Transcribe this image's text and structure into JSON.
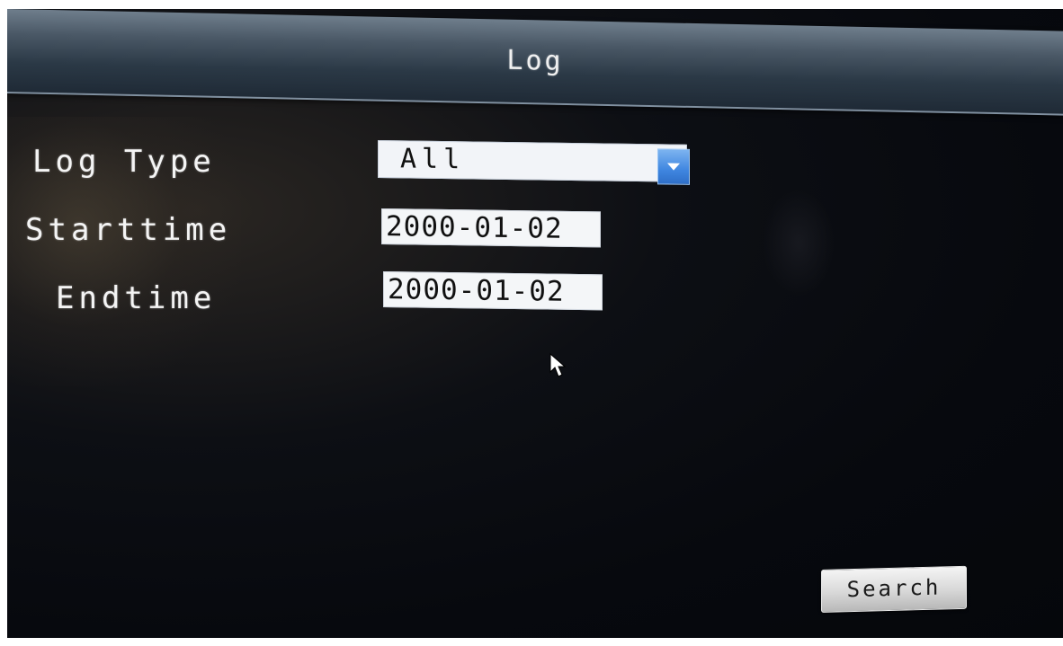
{
  "window": {
    "title": "Log"
  },
  "form": {
    "log_type_label": "Log Type",
    "log_type_value": "All",
    "starttime_label": "Starttime",
    "starttime_value": "2000-01-02",
    "endtime_label": "Endtime",
    "endtime_value": "2000-01-02"
  },
  "actions": {
    "search_label": "Search"
  },
  "icons": {
    "dropdown": "chevron-down-icon",
    "pointer": "mouse-cursor-icon"
  },
  "colors": {
    "title_bar": "#3a4856",
    "background": "#07090e",
    "dropdown_accent": "#3f86e0",
    "field_background": "#f2f4f8",
    "button_background": "#d8d8d8"
  }
}
